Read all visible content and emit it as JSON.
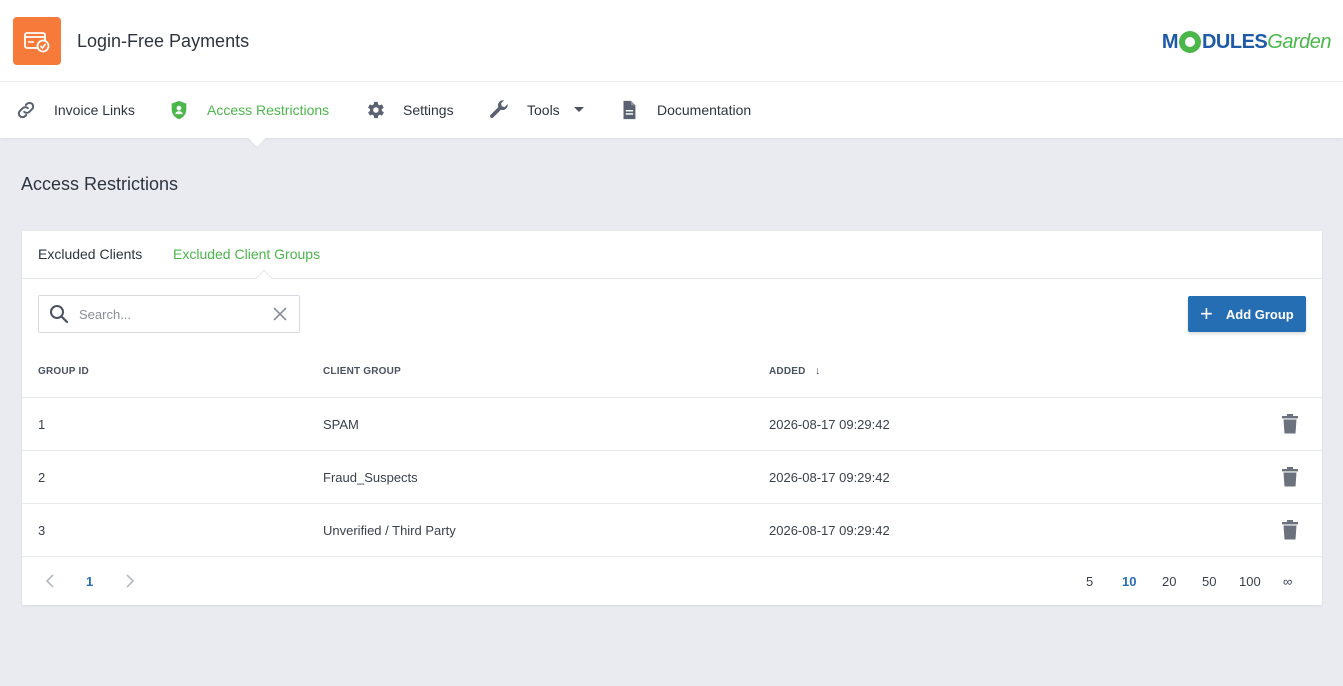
{
  "header": {
    "app_title": "Login-Free Payments",
    "brand_prefix": "M",
    "brand_mid": "DULES",
    "brand_suffix": "Garden",
    "app_logo_color": "#f67b3b"
  },
  "nav": {
    "items": [
      {
        "label": "Invoice Links",
        "icon": "link-icon"
      },
      {
        "label": "Access Restrictions",
        "icon": "shield-icon",
        "active": true
      },
      {
        "label": "Settings",
        "icon": "gear-icon"
      },
      {
        "label": "Tools",
        "icon": "wrench-icon",
        "has_dropdown": true
      },
      {
        "label": "Documentation",
        "icon": "document-icon"
      }
    ]
  },
  "page": {
    "title": "Access Restrictions"
  },
  "tabs": [
    {
      "label": "Excluded Clients"
    },
    {
      "label": "Excluded Client Groups",
      "active": true
    }
  ],
  "search": {
    "placeholder": "Search...",
    "value": ""
  },
  "toolbar": {
    "add_label": "Add Group"
  },
  "table": {
    "columns": [
      "GROUP ID",
      "CLIENT GROUP",
      "ADDED"
    ],
    "sort_indicator": "↓",
    "rows": [
      {
        "id": "1",
        "group": "SPAM",
        "added": "2026-08-17 09:29:42"
      },
      {
        "id": "2",
        "group": "Fraud_Suspects",
        "added": "2026-08-17 09:29:42"
      },
      {
        "id": "3",
        "group": "Unverified / Third Party",
        "added": "2026-08-17 09:29:42"
      }
    ]
  },
  "pagination": {
    "current_page": "1",
    "page_sizes": [
      "5",
      "10",
      "20",
      "50",
      "100",
      "∞"
    ],
    "selected_page_size": "10"
  },
  "colors": {
    "accent_green": "#4bb74a",
    "primary_blue": "#266eb3",
    "background": "#e9ebf0"
  }
}
